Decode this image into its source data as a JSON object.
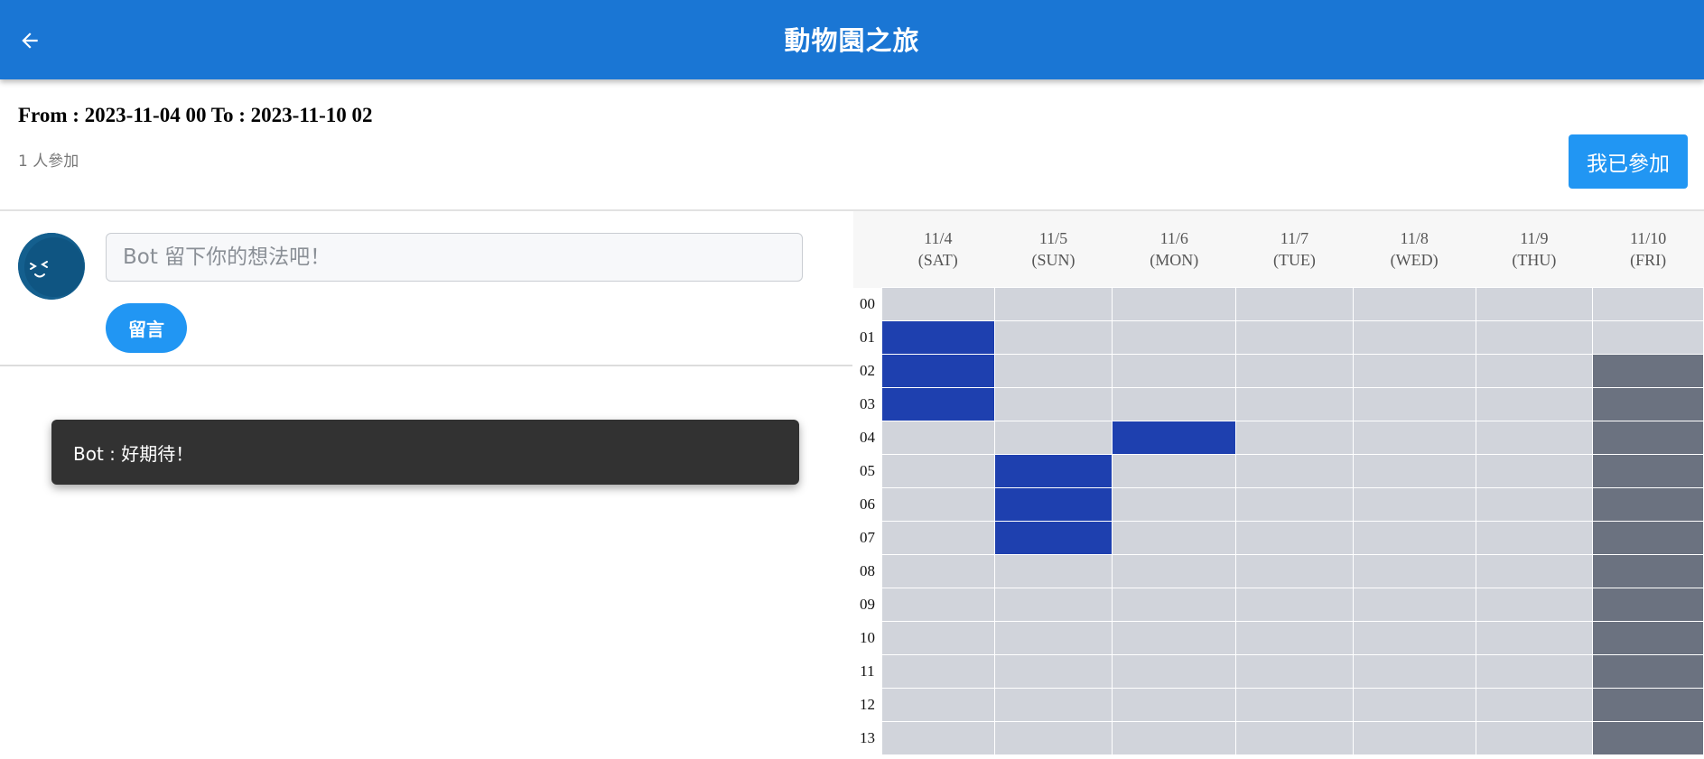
{
  "header": {
    "back_icon": "arrow-left-icon",
    "title": "動物園之旅"
  },
  "event": {
    "range": "From : 2023-11-04 00 To : 2023-11-10 02",
    "participants": "1 人參加",
    "join_button": "我已參加"
  },
  "comment_box": {
    "avatar_icon": "smiling-face-avatar",
    "placeholder": "Bot 留下你的想法吧！",
    "submit_label": "留言"
  },
  "comments": [
    {
      "text": "Bot : 好期待！"
    }
  ],
  "schedule": {
    "days": [
      {
        "date": "11/4",
        "weekday": "(SAT)"
      },
      {
        "date": "11/5",
        "weekday": "(SUN)"
      },
      {
        "date": "11/6",
        "weekday": "(MON)"
      },
      {
        "date": "11/7",
        "weekday": "(TUE)"
      },
      {
        "date": "11/8",
        "weekday": "(WED)"
      },
      {
        "date": "11/9",
        "weekday": "(THU)"
      },
      {
        "date": "11/10",
        "weekday": "(FRI)"
      }
    ],
    "hours": [
      "00",
      "01",
      "02",
      "03",
      "04",
      "05",
      "06",
      "07",
      "08",
      "09",
      "10",
      "11",
      "12",
      "13"
    ],
    "legend": {
      "0": "available",
      "1": "selected",
      "2": "out-of-range"
    },
    "colors": {
      "available": "#d1d4db",
      "selected": "#1e40af",
      "out_of_range": "#6b7280"
    },
    "cells": [
      [
        0,
        0,
        0,
        0,
        0,
        0,
        0
      ],
      [
        1,
        0,
        0,
        0,
        0,
        0,
        0
      ],
      [
        1,
        0,
        0,
        0,
        0,
        0,
        2
      ],
      [
        1,
        0,
        0,
        0,
        0,
        0,
        2
      ],
      [
        0,
        0,
        1,
        0,
        0,
        0,
        2
      ],
      [
        0,
        1,
        0,
        0,
        0,
        0,
        2
      ],
      [
        0,
        1,
        0,
        0,
        0,
        0,
        2
      ],
      [
        0,
        1,
        0,
        0,
        0,
        0,
        2
      ],
      [
        0,
        0,
        0,
        0,
        0,
        0,
        2
      ],
      [
        0,
        0,
        0,
        0,
        0,
        0,
        2
      ],
      [
        0,
        0,
        0,
        0,
        0,
        0,
        2
      ],
      [
        0,
        0,
        0,
        0,
        0,
        0,
        2
      ],
      [
        0,
        0,
        0,
        0,
        0,
        0,
        2
      ],
      [
        0,
        0,
        0,
        0,
        0,
        0,
        2
      ]
    ]
  }
}
